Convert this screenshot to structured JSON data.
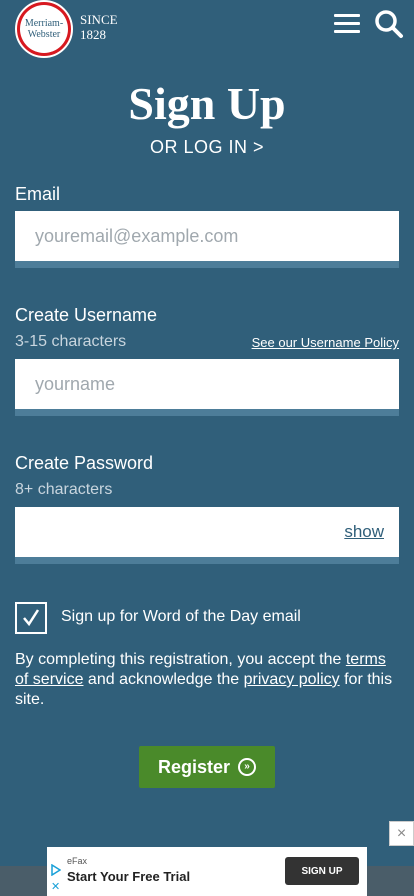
{
  "header": {
    "logo_line1": "Merriam-",
    "logo_line2": "Webster",
    "since_line1": "SINCE",
    "since_line2": "1828"
  },
  "page": {
    "title": "Sign Up",
    "login_link": "OR LOG IN >"
  },
  "form": {
    "email_label": "Email",
    "email_placeholder": "youremail@example.com",
    "username_label": "Create Username",
    "username_hint": "3-15 characters",
    "username_policy_link": "See our Username Policy",
    "username_placeholder": "yourname",
    "password_label": "Create Password",
    "password_hint": "8+ characters",
    "password_show": "show",
    "wotd_label": "Sign up for Word of the Day email",
    "wotd_checked": true,
    "terms_prefix": "By completing this registration, you accept the",
    "terms_link": "terms of service",
    "terms_middle": "and acknowledge the",
    "privacy_link": "privacy policy",
    "terms_suffix": "for this site.",
    "register_label": "Register"
  },
  "ad": {
    "brand": "eFax",
    "text": "Start Your Free Trial",
    "button": "SIGN UP",
    "close": "×"
  },
  "colors": {
    "background": "#305f7a",
    "register_button": "#4a8a2a",
    "logo_ring": "#d71920"
  }
}
